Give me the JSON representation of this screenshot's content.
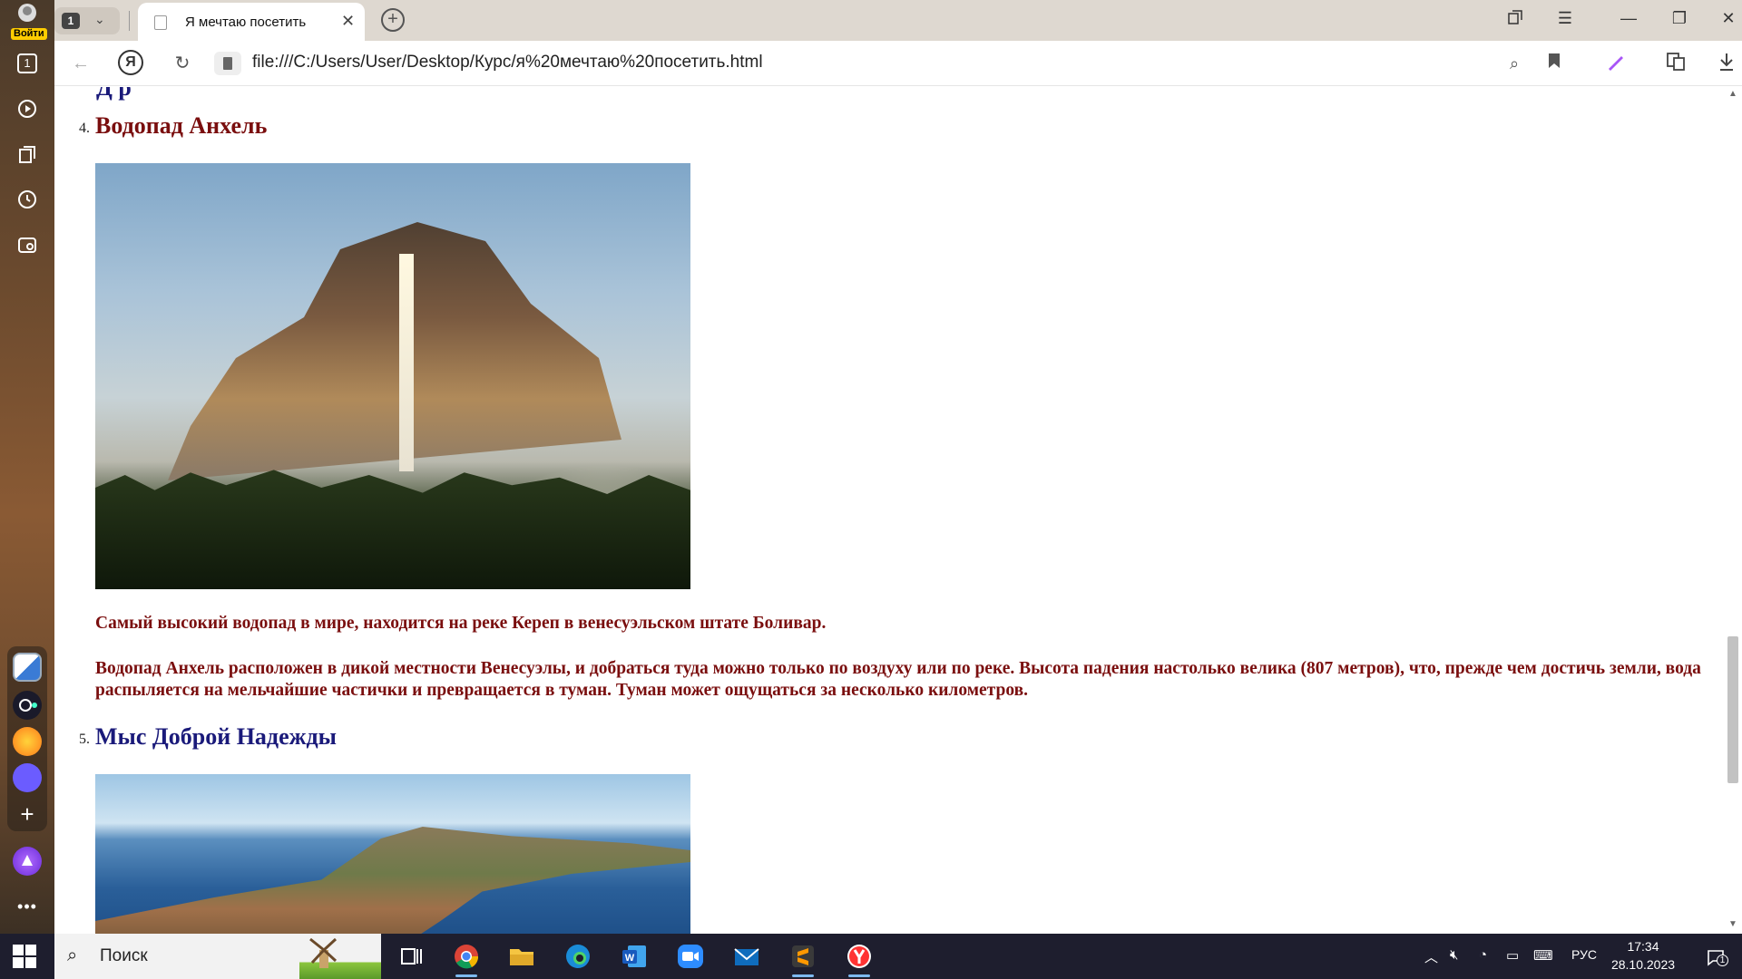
{
  "browser": {
    "sidebar": {
      "login_label": "Войти",
      "tab_count": "1"
    },
    "tab": {
      "title": "Я мечтаю посетить",
      "count": "1"
    },
    "address": {
      "url": "file:///C:/Users/User/Desktop/Курс/я%20мечтаю%20посетить.html",
      "ya_label": "Я"
    }
  },
  "page": {
    "items": [
      {
        "number": "4.",
        "title": "Водопад Анхель",
        "title_color": "#7a0e0e",
        "paragraphs": [
          "Самый высокий водопад в мире, находится на реке Кереп в венесуэльском штате Боливар.",
          "Водопад Анхель расположен в дикой местности Венесуэлы, и добраться туда можно только по воздуху или по реке. Высота падения настолько велика (807 метров), что, прежде чем достичь земли, вода распыляется на мельчайшие частички и превращается в туман. Туман может ощущаться за несколько километров."
        ]
      },
      {
        "number": "5.",
        "title": "Мыс Доброй Надежды",
        "title_color": "#1a1a7a"
      }
    ],
    "text_color": "#7a0e0e"
  },
  "taskbar": {
    "search_placeholder": "Поиск",
    "language": "РУС",
    "time": "17:34",
    "date": "28.10.2023",
    "notification_count": "1"
  }
}
